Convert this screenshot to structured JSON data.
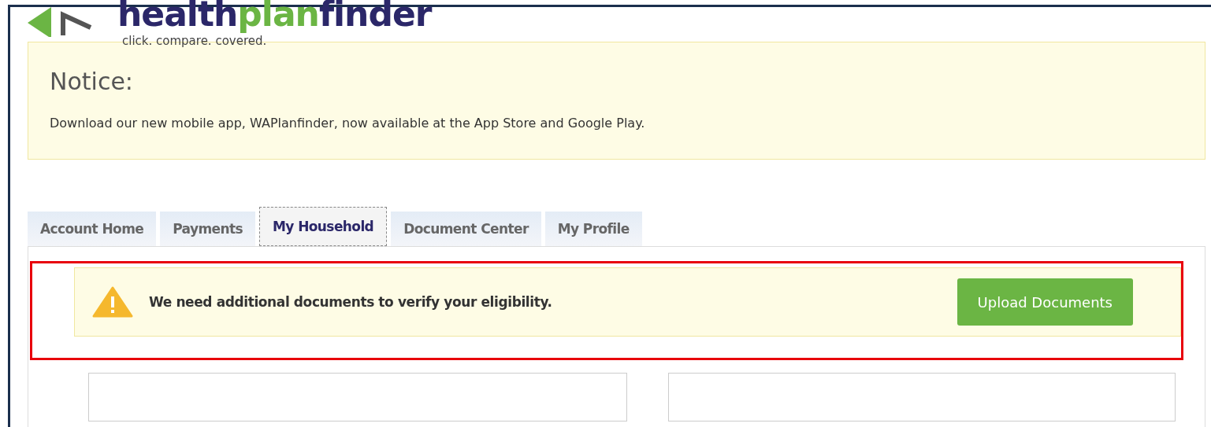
{
  "logo": {
    "parts": [
      "health",
      "plan",
      "finder"
    ],
    "tagline": "click. compare. covered."
  },
  "notice": {
    "title": "Notice:",
    "message": "Download our new mobile app, WAPlanfinder, now available at the App Store and Google Play."
  },
  "tabs": [
    {
      "label": "Account Home",
      "selected": false
    },
    {
      "label": "Payments",
      "selected": false
    },
    {
      "label": "My Household",
      "selected": true
    },
    {
      "label": "Document Center",
      "selected": false
    },
    {
      "label": "My Profile",
      "selected": false
    }
  ],
  "alert": {
    "message": "We need additional documents to verify your eligibility.",
    "button": "Upload Documents"
  }
}
